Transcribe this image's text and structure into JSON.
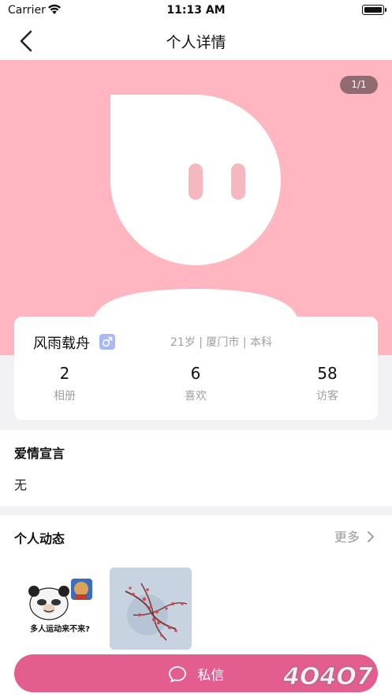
{
  "status_bar": {
    "carrier": "Carrier",
    "time": "11:13 AM"
  },
  "nav": {
    "title": "个人详情",
    "back_icon": "chevron-left-icon"
  },
  "hero": {
    "page_indicator": "1/1",
    "background_color": "#ffb6c1"
  },
  "profile": {
    "nickname": "风雨载舟",
    "gender_icon": "male-icon",
    "info": "21岁 | 厦门市 | 本科",
    "stats": [
      {
        "value": "2",
        "label": "相册"
      },
      {
        "value": "6",
        "label": "喜欢"
      },
      {
        "value": "58",
        "label": "访客"
      }
    ]
  },
  "love_declaration": {
    "title": "爱情宣言",
    "text": "无"
  },
  "moments": {
    "title": "个人动态",
    "more_label": "更多",
    "thumbnails": [
      {
        "caption": "多人运动来不来?"
      },
      {
        "caption": ""
      }
    ]
  },
  "actions": {
    "private_message_label": "私信",
    "accent_color": "#e35d8f"
  },
  "watermark": {
    "text": "4O4O7"
  }
}
